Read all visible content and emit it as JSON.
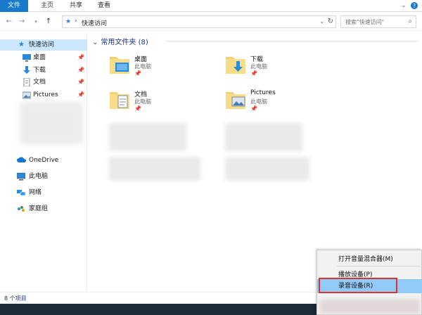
{
  "ribbon": {
    "tabs": [
      "文件",
      "主页",
      "共享",
      "查看"
    ],
    "collapse_icon": "chevron-down-icon",
    "help_icon": "help-icon"
  },
  "address": {
    "breadcrumb": "快速访问",
    "search_placeholder": "搜索\"快速访问\""
  },
  "sidebar": {
    "items": [
      {
        "label": "快速访问",
        "icon": "star-icon",
        "selected": true,
        "pinned": false
      },
      {
        "label": "桌面",
        "icon": "desktop-icon",
        "pinned": true
      },
      {
        "label": "下载",
        "icon": "download-icon",
        "pinned": true
      },
      {
        "label": "文档",
        "icon": "document-icon",
        "pinned": true
      },
      {
        "label": "Pictures",
        "icon": "pictures-icon",
        "pinned": true
      },
      {
        "label": "OneDrive",
        "icon": "cloud-icon"
      },
      {
        "label": "此电脑",
        "icon": "computer-icon"
      },
      {
        "label": "网络",
        "icon": "network-icon"
      },
      {
        "label": "家庭组",
        "icon": "homegroup-icon"
      }
    ]
  },
  "content": {
    "group_header": "常用文件夹 (8)",
    "folders": [
      {
        "name": "桌面",
        "sub": "此电脑"
      },
      {
        "name": "下载",
        "sub": "此电脑"
      },
      {
        "name": "文档",
        "sub": "此电脑"
      },
      {
        "name": "Pictures",
        "sub": "此电脑"
      }
    ]
  },
  "status": {
    "count": "8 个项目"
  },
  "context_menu": {
    "items": [
      {
        "label": "打开音量混合器(M)"
      },
      {
        "label": "播放设备(P)"
      },
      {
        "label": "录音设备(R)",
        "highlighted": true
      }
    ]
  },
  "colors": {
    "accent": "#1979ca",
    "selection": "#cce8ff",
    "menu_highlight": "#91c9f7",
    "annotation_red": "#e03030",
    "group_header": "#1e3287"
  }
}
